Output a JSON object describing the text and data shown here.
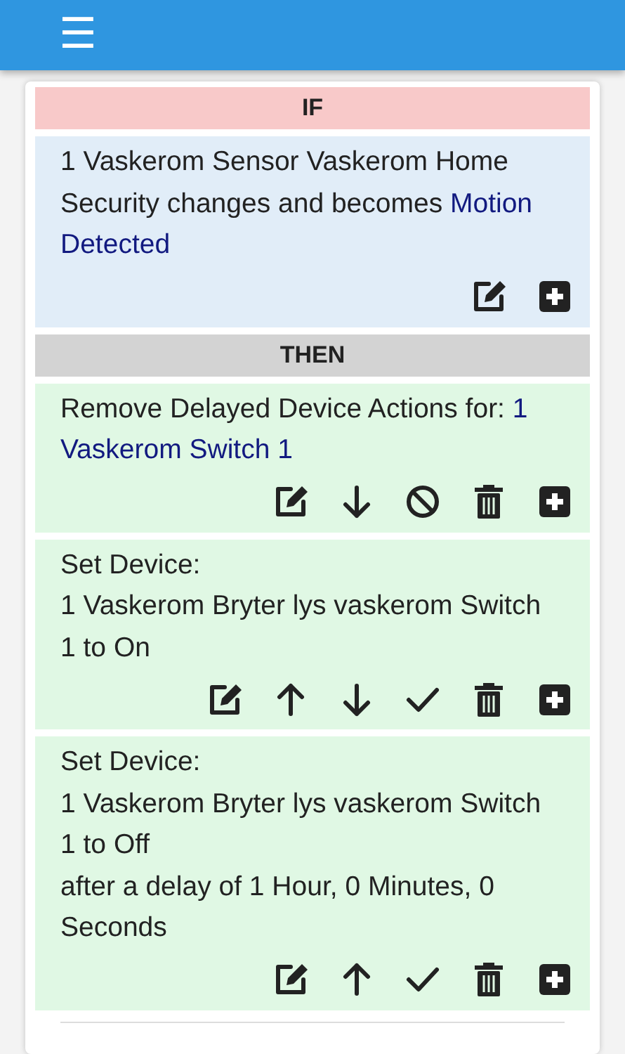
{
  "navbar": {
    "menu_icon": "☰"
  },
  "sections": [
    {
      "kind": "if",
      "title": "IF",
      "blocks": [
        {
          "lines": [
            {
              "text": "1 Vaskerom Sensor Vaskerom Home Security changes and becomes ",
              "value": "Motion Detected"
            }
          ],
          "actions": [
            {
              "kind": "edit"
            },
            {
              "kind": "add"
            }
          ]
        }
      ]
    },
    {
      "kind": "then",
      "title": "THEN",
      "blocks": [
        {
          "lines": [
            {
              "text": "Remove Delayed Device Actions for: ",
              "value": "1 Vaskerom Switch 1"
            }
          ],
          "actions": [
            {
              "kind": "edit"
            },
            {
              "kind": "down"
            },
            {
              "kind": "disable"
            },
            {
              "kind": "delete"
            },
            {
              "kind": "add"
            }
          ]
        },
        {
          "lines": [
            {
              "text": "Set Device:"
            },
            {
              "text": "1 Vaskerom Bryter lys vaskerom Switch 1 to On"
            }
          ],
          "actions": [
            {
              "kind": "edit"
            },
            {
              "kind": "up"
            },
            {
              "kind": "down"
            },
            {
              "kind": "enable"
            },
            {
              "kind": "delete"
            },
            {
              "kind": "add"
            }
          ]
        },
        {
          "lines": [
            {
              "text": "Set Device:"
            },
            {
              "text": "1 Vaskerom Bryter lys vaskerom Switch 1 to Off"
            },
            {
              "text": "after a delay of 1 Hour, 0 Minutes, 0 Seconds"
            }
          ],
          "actions": [
            {
              "kind": "edit"
            },
            {
              "kind": "up"
            },
            {
              "kind": "enable"
            },
            {
              "kind": "delete"
            },
            {
              "kind": "add"
            }
          ]
        }
      ]
    }
  ]
}
